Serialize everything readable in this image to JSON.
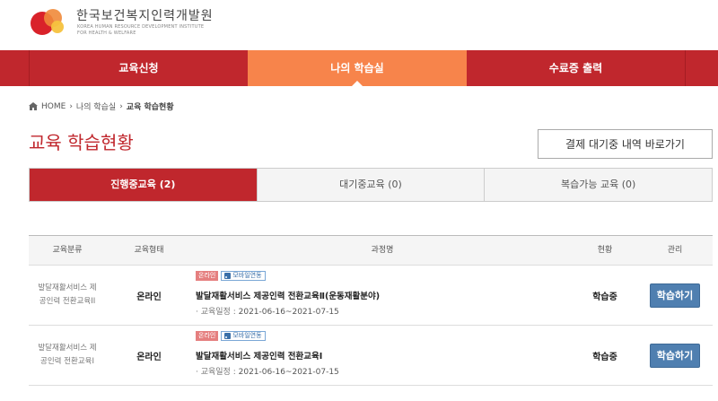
{
  "logo": {
    "title": "한국보건복지인력개발원",
    "sub1": "KOREA HUMAN RESOURCE DEVELOPMENT INSTITUTE",
    "sub2": "FOR HEALTH & WELFARE"
  },
  "nav": {
    "items": [
      "교육신청",
      "나의 학습실",
      "수료증 출력"
    ],
    "active_index": 1
  },
  "breadcrumb": {
    "home": "HOME",
    "sep": "›",
    "items": [
      "나의 학습실",
      "교육 학습현황"
    ]
  },
  "page": {
    "title": "교육 학습현황",
    "pending_button": "결제 대기중 내역 바로가기"
  },
  "tabs": [
    {
      "label": "진행중교육 (2)",
      "active": true
    },
    {
      "label": "대기중교육 (0)",
      "active": false
    },
    {
      "label": "복습가능 교육 (0)",
      "active": false
    }
  ],
  "table": {
    "headers": [
      "교육분류",
      "교육형태",
      "과정명",
      "현황",
      "관리"
    ],
    "rows": [
      {
        "category_line1": "발달재활서비스 제",
        "category_line2": "공인력 전환교육II",
        "type": "온라인",
        "badge_online": "온라인",
        "badge_mobile": "모바일연동",
        "course": "발달재활서비스 제공인력 전환교육Ⅱ(운동재활분야)",
        "date_label": "· 교육일정 :",
        "date": "2021-06-16~2021-07-15",
        "status": "학습중",
        "action": "학습하기"
      },
      {
        "category_line1": "발달재활서비스 제",
        "category_line2": "공인력 전환교육I",
        "type": "온라인",
        "badge_online": "온라인",
        "badge_mobile": "모바일연동",
        "course": "발달재활서비스 제공인력 전환교육Ⅰ",
        "date_label": "· 교육일정 :",
        "date": "2021-06-16~2021-07-15",
        "status": "학습중",
        "action": "학습하기"
      }
    ]
  },
  "colors": {
    "brand_red": "#c0272d",
    "nav_active_orange": "#f7844b",
    "button_blue": "#4f7fb0"
  }
}
